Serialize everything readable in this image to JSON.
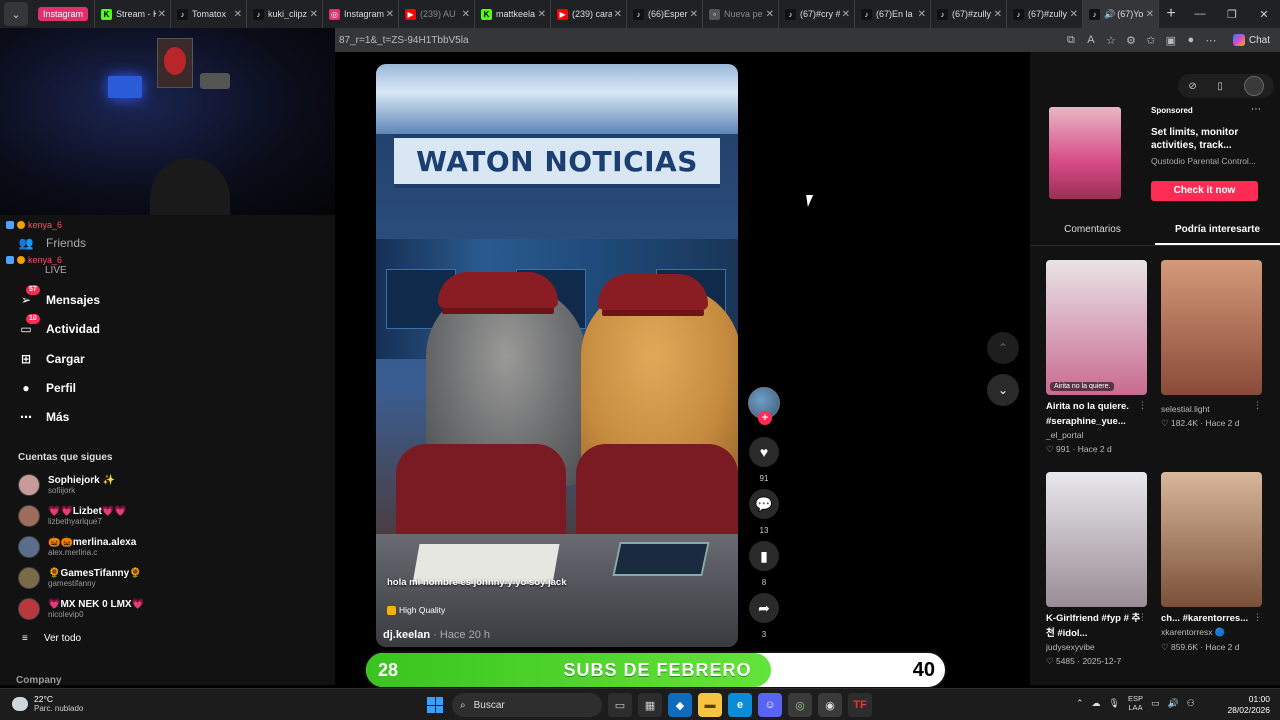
{
  "browser": {
    "tabs": [
      {
        "label": "Instagram",
        "icon_color": "#e1306c",
        "icon": "instagram-icon",
        "pill": true
      },
      {
        "label": "Stream - K",
        "icon_color": "#53fc18",
        "icon": "kick-icon"
      },
      {
        "label": "Tomatox",
        "icon_color": "#111111",
        "icon": "tiktok-icon"
      },
      {
        "label": "kuki_clipz",
        "icon_color": "#111111",
        "icon": "tiktok-icon"
      },
      {
        "label": "Instagram",
        "icon_color": "#e1306c",
        "icon": "instagram-icon"
      },
      {
        "label": "(239) AU",
        "icon_color": "#ff0000",
        "icon": "youtube-icon",
        "dim": true
      },
      {
        "label": "mattkeela",
        "icon_color": "#53fc18",
        "icon": "kick-icon"
      },
      {
        "label": "(239) cara",
        "icon_color": "#ff0000",
        "icon": "youtube-icon"
      },
      {
        "label": "(66)Esper",
        "icon_color": "#111111",
        "icon": "tiktok-icon"
      },
      {
        "label": "Nueva pe",
        "icon_color": "#555555",
        "icon": "new-page-icon",
        "dim": true
      },
      {
        "label": "(67)#cry #",
        "icon_color": "#111111",
        "icon": "tiktok-icon"
      },
      {
        "label": "(67)En la",
        "icon_color": "#111111",
        "icon": "tiktok-icon"
      },
      {
        "label": "(67)#zully",
        "icon_color": "#111111",
        "icon": "tiktok-icon"
      },
      {
        "label": "(67)#zully",
        "icon_color": "#111111",
        "icon": "tiktok-icon"
      },
      {
        "label": "(67)Yo",
        "icon_color": "#111111",
        "icon": "tiktok-icon",
        "active": true
      }
    ],
    "url": "87_r=1&_t=ZS-94H1TbbV5la",
    "chat_label": "Chat"
  },
  "overlay_chat": {
    "user1": "kenya_6",
    "user2": "kenya_6"
  },
  "sidebar": {
    "friends_label": "Friends",
    "live_label": "LIVE",
    "nav": [
      {
        "label": "Mensajes",
        "icon": "send-icon",
        "badge": "57"
      },
      {
        "label": "Actividad",
        "icon": "inbox-icon",
        "badge": "10"
      },
      {
        "label": "Cargar",
        "icon": "upload-icon"
      },
      {
        "label": "Perfil",
        "icon": "profile-icon"
      },
      {
        "label": "Más",
        "icon": "more-icon"
      }
    ],
    "following_title": "Cuentas que sigues",
    "following": [
      {
        "name": "Sophiejork ✨",
        "user": "sofiijork",
        "color": "#c89b9b"
      },
      {
        "name": "💗💗Lizbet💗💗",
        "user": "lizbethyarlque7",
        "color": "#9e6b5c"
      },
      {
        "name": "🎃🎃merlina.alexa",
        "user": "alex.merlina.c",
        "color": "#5a6e8c"
      },
      {
        "name": "🌻GamesTifanny🌻",
        "user": "gamestifanny",
        "color": "#7a6a4a"
      },
      {
        "name": "💗MX NEK 0 LMX💗",
        "user": "nicolevip0",
        "color": "#b8383e"
      }
    ],
    "see_all": "Ver todo",
    "company": "Company"
  },
  "video": {
    "sign_text": "WATON NOTICIAS",
    "caption": "hola mi nombre es johnny y yo soy jack",
    "quality": "High Quality",
    "author": "dj.keelan",
    "time": "Hace 20 h",
    "likes": "91",
    "comments": "13",
    "saves": "8",
    "shares": "3"
  },
  "ad": {
    "sponsored": "Sponsored",
    "title": "Set limits, monitor activities, track...",
    "advertiser": "Qustodio Parental Control...",
    "cta": "Check it now"
  },
  "right_tabs": {
    "comments": "Comentarios",
    "interest": "Podría interesarte"
  },
  "cards": [
    {
      "title": "Airita no la quiere. #seraphine_yue...",
      "user": "_el_portal",
      "stats": "♡ 991 · Hace 2 d",
      "tag": "Airita no la quiere.",
      "color_top": "#e9e4e6",
      "color_bottom": "#c96b8f"
    },
    {
      "title": "",
      "user": "selestial.light",
      "stats": "♡ 182.4K · Hace 2 d",
      "tag": "",
      "color_top": "#d49a7a",
      "color_bottom": "#8a4a38"
    },
    {
      "title": "K-Girlfriend #fyp # 추천 #idol...",
      "user": "judysexyvibe",
      "stats": "♡ 5485 · 2025-12-7",
      "tag": "",
      "color_top": "#e8e8ec",
      "color_bottom": "#9a8c94"
    },
    {
      "title": "ch... #karentorres...",
      "user": "xkarentorresx 🔵",
      "stats": "♡ 859.6K · Hace 2 d",
      "tag": "",
      "color_top": "#d8b79a",
      "color_bottom": "#7a5038"
    }
  ],
  "subs": {
    "current": "28",
    "label": "SUBS DE FEBRERO",
    "goal": "40",
    "progress": 0.7
  },
  "taskbar": {
    "temp": "22°C",
    "condition": "Parc. nublado",
    "search": "Buscar",
    "lang1": "ESP",
    "lang2": "LAA",
    "time": "01:00",
    "date": "28/02/2026"
  }
}
